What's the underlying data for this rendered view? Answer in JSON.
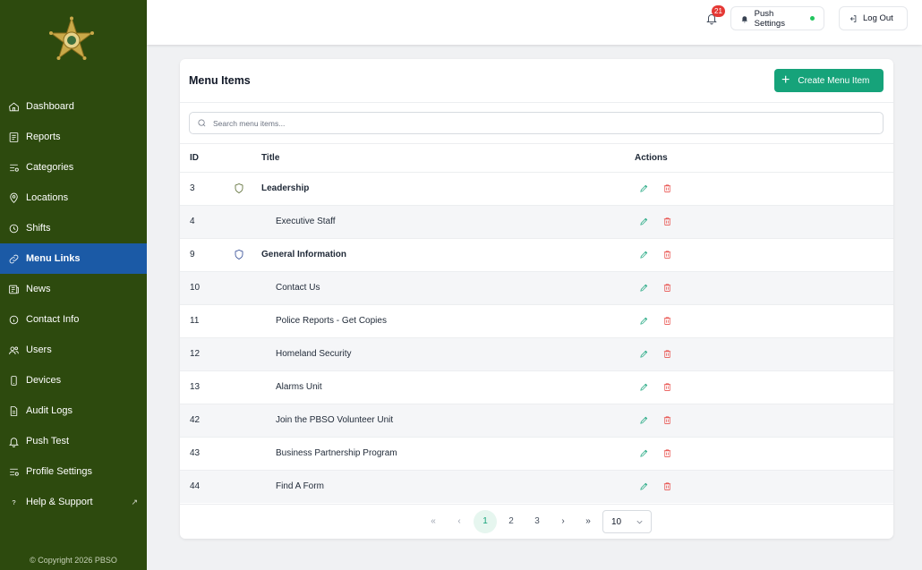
{
  "sidebar": {
    "logo_icon": "star-badge-icon",
    "items": [
      {
        "label": "Dashboard",
        "icon": "home-icon"
      },
      {
        "label": "Reports",
        "icon": "report-icon"
      },
      {
        "label": "Categories",
        "icon": "categories-icon"
      },
      {
        "label": "Locations",
        "icon": "location-pin-icon"
      },
      {
        "label": "Shifts",
        "icon": "clock-icon"
      },
      {
        "label": "Menu Links",
        "icon": "link-icon",
        "active": true
      },
      {
        "label": "News",
        "icon": "news-icon"
      },
      {
        "label": "Contact Info",
        "icon": "info-icon"
      },
      {
        "label": "Users",
        "icon": "users-icon"
      },
      {
        "label": "Devices",
        "icon": "device-icon"
      },
      {
        "label": "Audit Logs",
        "icon": "document-icon"
      },
      {
        "label": "Push Test",
        "icon": "bell-icon"
      },
      {
        "label": "Profile Settings",
        "icon": "settings-icon"
      },
      {
        "label": "Help & Support",
        "icon": "question-icon",
        "external": true
      }
    ],
    "copyright": "© Copyright 2026 PBSO"
  },
  "topbar": {
    "notification_count": "21",
    "push_settings_label": "Push Settings",
    "push_status_color": "#22c55e",
    "logout_label": "Log Out"
  },
  "main": {
    "title": "Menu Items",
    "create_button_label": "Create Menu Item",
    "search_placeholder": "Search menu items...",
    "columns": {
      "id": "ID",
      "title": "Title",
      "actions": "Actions"
    },
    "rows": [
      {
        "id": "3",
        "title": "Leadership",
        "level": "parent",
        "shield_color": "#4a5d1e"
      },
      {
        "id": "4",
        "title": "Executive Staff",
        "level": "child"
      },
      {
        "id": "9",
        "title": "General Information",
        "level": "parent",
        "shield_color": "#1e3a8a"
      },
      {
        "id": "10",
        "title": "Contact Us",
        "level": "child"
      },
      {
        "id": "11",
        "title": "Police Reports - Get Copies",
        "level": "child"
      },
      {
        "id": "12",
        "title": "Homeland Security",
        "level": "child"
      },
      {
        "id": "13",
        "title": "Alarms Unit",
        "level": "child"
      },
      {
        "id": "42",
        "title": "Join the PBSO Volunteer Unit",
        "level": "child"
      },
      {
        "id": "43",
        "title": "Business Partnership Program",
        "level": "child"
      },
      {
        "id": "44",
        "title": "Find A Form",
        "level": "child"
      }
    ],
    "pagination": {
      "first": "«",
      "prev": "‹",
      "pages": [
        "1",
        "2",
        "3"
      ],
      "current_page": "1",
      "next": "›",
      "last": "»",
      "page_size": "10"
    }
  },
  "colors": {
    "sidebar_bg": "#2d4a0e",
    "active_nav": "#1b5aa6",
    "accent": "#16a37a",
    "danger": "#e53935"
  }
}
